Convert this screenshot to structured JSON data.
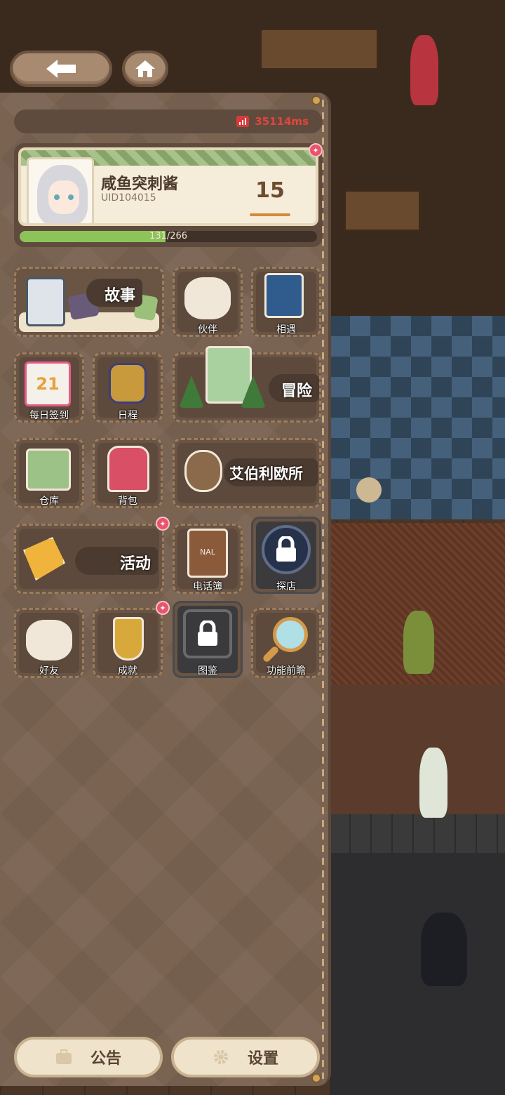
{
  "header": {
    "back_icon": "back-arrow-icon",
    "home_icon": "home-icon"
  },
  "status": {
    "ping_icon": "signal-icon",
    "latency": "35114ms",
    "latency_color": "#e2453e"
  },
  "profile": {
    "name": "咸鱼突刺酱",
    "uid": "UID104015",
    "level": "15",
    "xp_text_current": "131",
    "xp_text_max": "/266",
    "xp_fraction": 0.49,
    "accent": "#8cc45a"
  },
  "menu": {
    "story": "故事",
    "partner": "伙伴",
    "encounter": "相遇",
    "daily_checkin": "每日签到",
    "daily_checkin_date": "21",
    "schedule": "日程",
    "adventure": "冒险",
    "warehouse": "仓库",
    "backpack": "背包",
    "office": "艾伯利欧所",
    "event": "活动",
    "phonebook": "电话簿",
    "phonebook_cover": "NAL",
    "explore_shop": "探店",
    "friends": "好友",
    "achievements": "成就",
    "gallery": "图鉴",
    "preview": "功能前瞻"
  },
  "footer": {
    "notice": "公告",
    "settings": "设置",
    "notice_icon": "briefcase-icon",
    "settings_icon": "gear-icon"
  },
  "notification_color": "#e8546c"
}
